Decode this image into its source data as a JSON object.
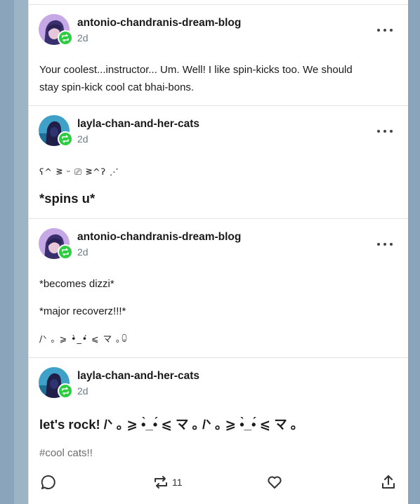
{
  "posts": [
    {
      "blog": "antonio-chandranis-dream-blog",
      "time": "2d",
      "lines": [
        "Your coolest...instructor... Um. Well! I like spin-kicks too. We should",
        "stay spin-kick cool cat bhai-bons."
      ]
    },
    {
      "blog": "layla-chan-and-her-cats",
      "time": "2d",
      "kaomoji": "ʕ^ ᕒ ᵕ ⎚ ᕒ^ʔ ⋰",
      "big": "*spins u*"
    },
    {
      "blog": "antonio-chandranis-dream-blog",
      "time": "2d",
      "lines": [
        "*becomes dizzi*",
        "*major recoverz!!!*"
      ],
      "kaomoji": "/ᐠ ｡ ⩾ •̀_•́ ⩽ マ ｡ꐑ"
    },
    {
      "blog": "layla-chan-and-her-cats",
      "time": "2d",
      "big": "let's rock! /ᐠ ｡ ⩾ •̀_•́ ⩽ マ ｡ /ᐠ ｡ ⩾ •̀_•́ ⩽ マ ｡",
      "tag": "#cool cats!!"
    }
  ],
  "actions": {
    "reply_icon": "comment-icon",
    "reblog_icon": "reblog-icon",
    "reblog_count": "11",
    "like_icon": "heart-icon",
    "share_icon": "share-icon"
  },
  "colors": {
    "background": "#8aa4bb",
    "card": "#ffffff",
    "badge_green": "#2ecc40",
    "muted": "#6b7b8a"
  }
}
